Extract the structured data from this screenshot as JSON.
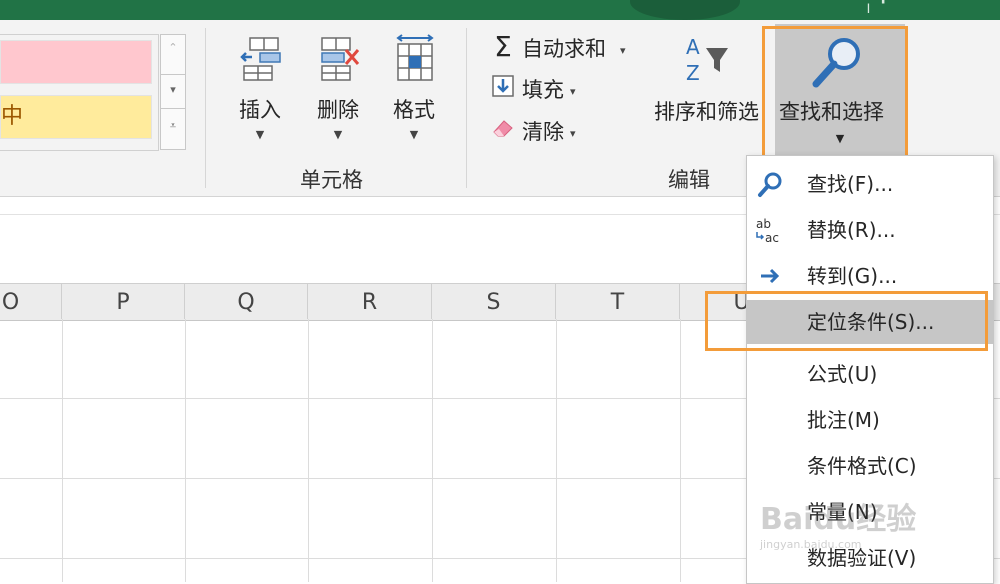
{
  "styles_gallery": {
    "cells": [
      {
        "label": "",
        "color": "#ffc7ce"
      },
      {
        "label": "中",
        "color": "#ffeb9c"
      }
    ]
  },
  "cells_group": {
    "label": "单元格",
    "buttons": [
      {
        "label": "插入",
        "icon": "insert-cells-icon"
      },
      {
        "label": "删除",
        "icon": "delete-cells-icon"
      },
      {
        "label": "格式",
        "icon": "format-cells-icon"
      }
    ]
  },
  "edit_group": {
    "label": "编辑",
    "autosum": {
      "symbol": "Σ",
      "label": "自动求和"
    },
    "fill": {
      "label": "填充"
    },
    "clear": {
      "label": "清除"
    },
    "sort_filter": {
      "label": "排序和筛选"
    },
    "find_select": {
      "label": "查找和选择"
    }
  },
  "columns": [
    "O",
    "P",
    "Q",
    "R",
    "S",
    "T",
    "U"
  ],
  "menu": {
    "items": [
      {
        "label": "查找(F)...",
        "icon": "search-icon"
      },
      {
        "label": "替换(R)...",
        "icon": "replace-icon"
      },
      {
        "label": "转到(G)...",
        "icon": "arrow-right-icon"
      },
      {
        "label": "定位条件(S)...",
        "icon": "",
        "highlighted": true
      },
      {
        "label": "公式(U)",
        "icon": ""
      },
      {
        "label": "批注(M)",
        "icon": ""
      },
      {
        "label": "条件格式(C)",
        "icon": ""
      },
      {
        "label": "常量(N)",
        "icon": ""
      },
      {
        "label": "数据验证(V)",
        "icon": ""
      }
    ]
  },
  "watermark": {
    "text": "Baidu经验",
    "subtext": "jingyan.baidu.com"
  },
  "colors": {
    "accent": "#f39c3a",
    "excel_green": "#217346",
    "ribbon": "#f3f3f3"
  }
}
